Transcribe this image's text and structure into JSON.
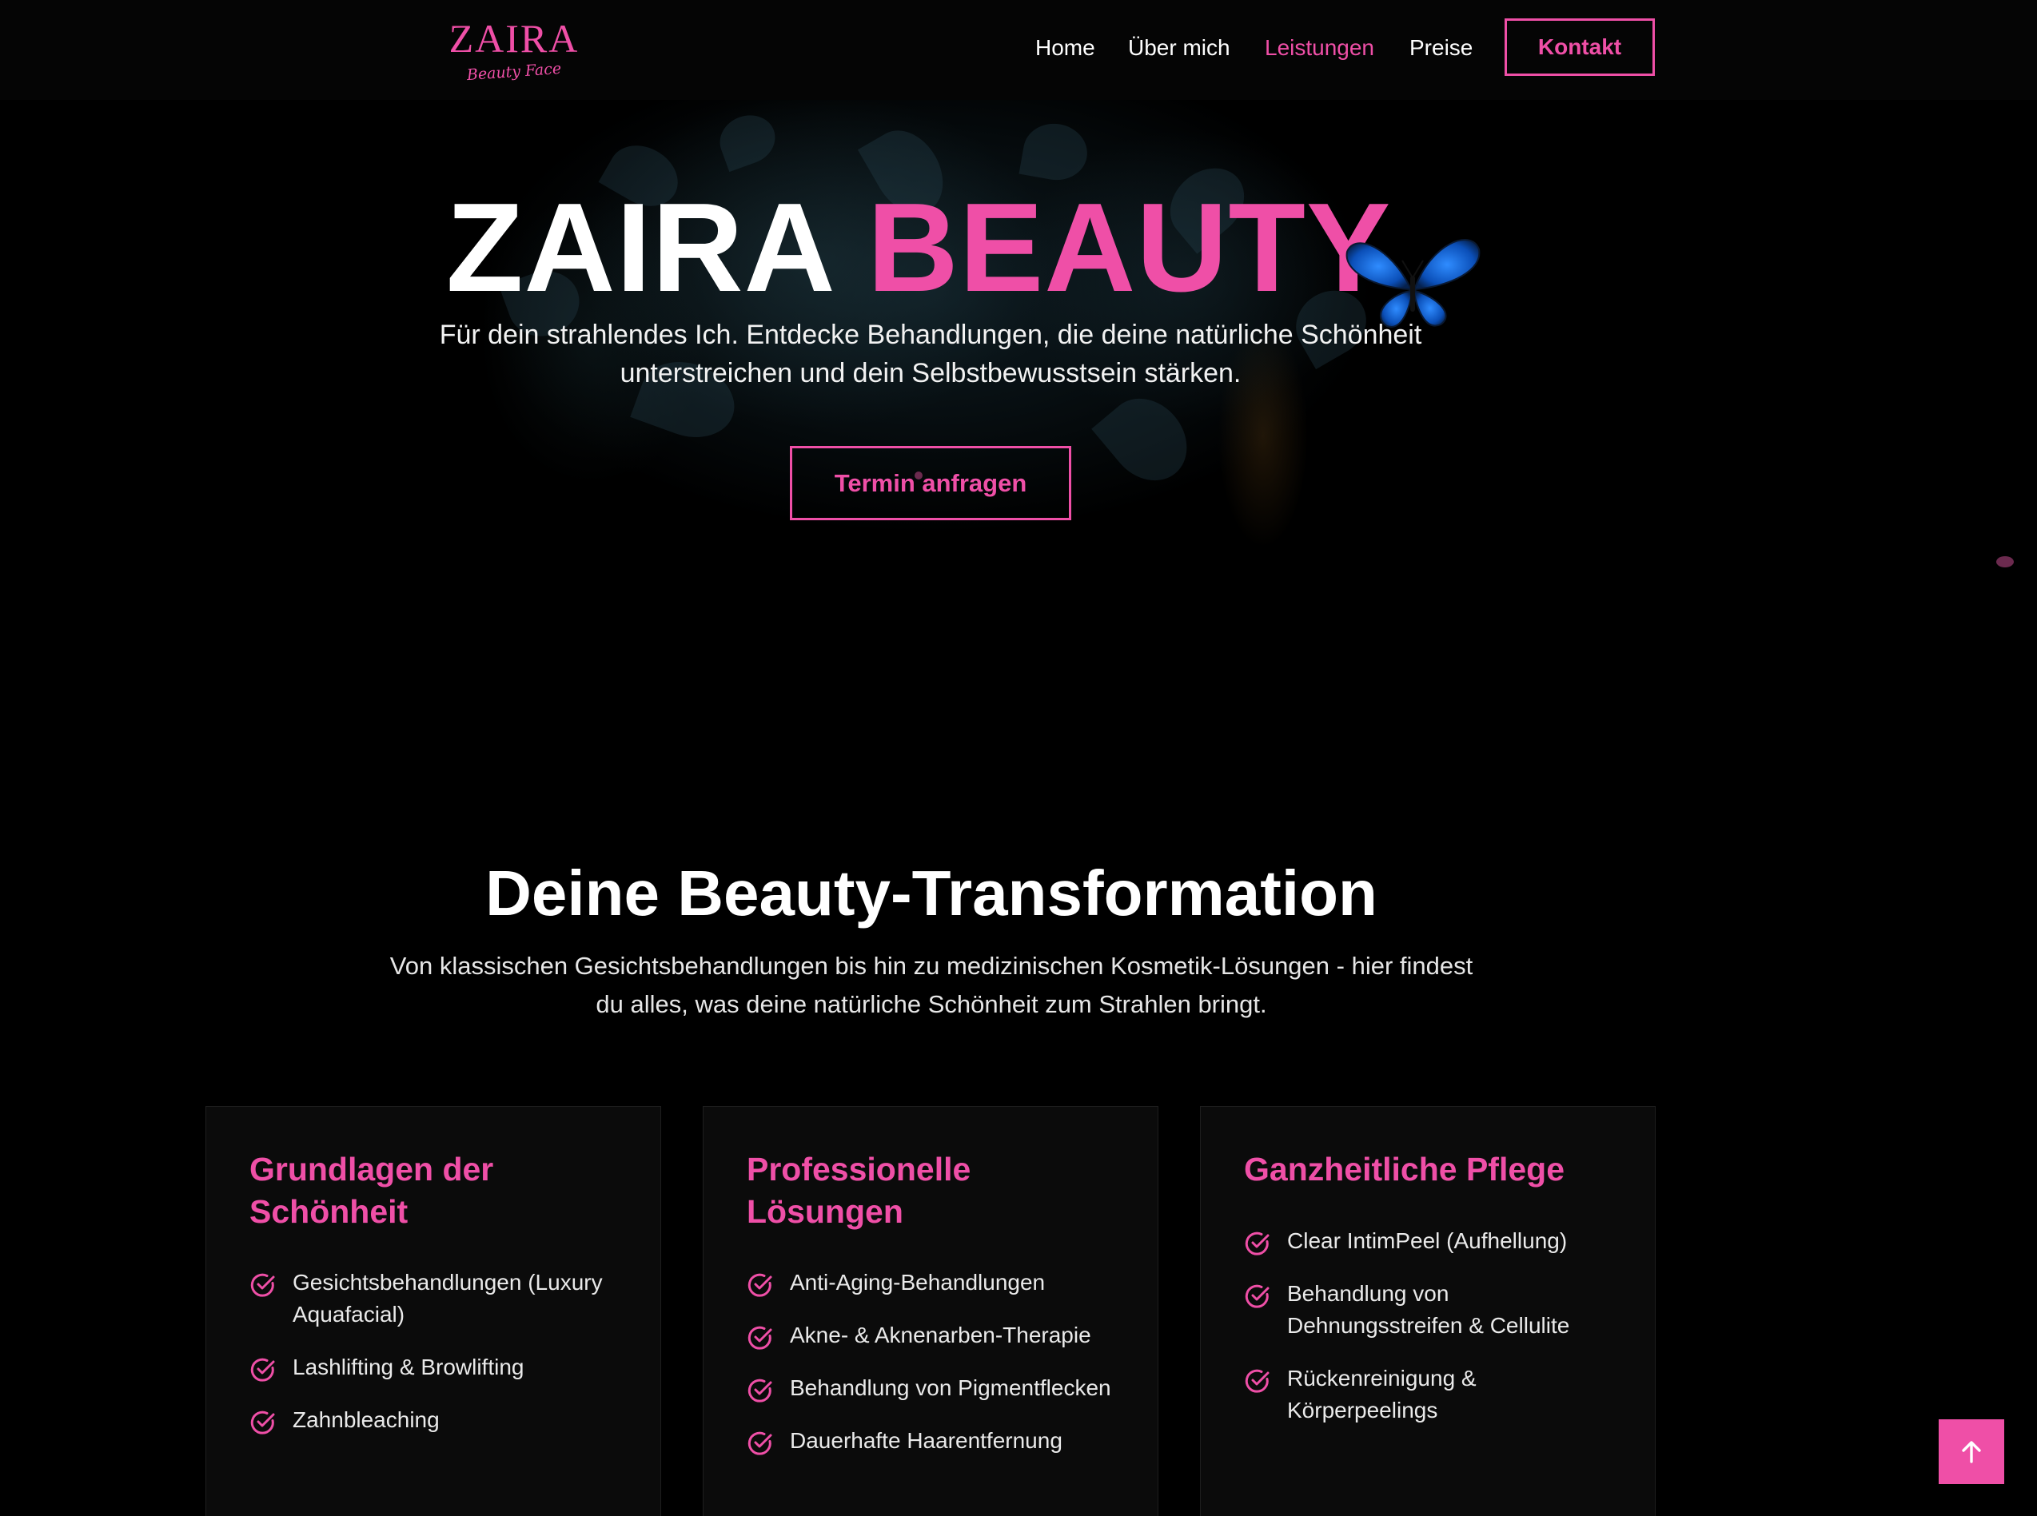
{
  "nav": {
    "logo_main": "ZAIRA",
    "logo_sub": "Beauty Face",
    "links": [
      "Home",
      "Über mich",
      "Leistungen",
      "Preise"
    ],
    "active": "Leistungen",
    "contact_label": "Kontakt"
  },
  "hero": {
    "title_white": "ZAIRA",
    "title_pink": "BEAUTY",
    "subtitle": "Für dein strahlendes Ich. Entdecke Behandlungen, die deine natürliche Schönheit unterstreichen und dein Selbstbewusstsein stärken.",
    "cta_label": "Termin anfragen"
  },
  "section": {
    "title": "Deine Beauty-Transformation",
    "subtitle": "Von klassischen Gesichtsbehandlungen bis hin zu medizinischen Kosmetik-Lösungen - hier findest du alles, was deine natürliche Schönheit zum Strahlen bringt."
  },
  "cards": [
    {
      "title": "Grundlagen der Schönheit",
      "items": [
        "Gesichtsbehandlungen (Luxury Aquafacial)",
        "Lashlifting & Browlifting",
        "Zahnbleaching"
      ]
    },
    {
      "title": "Professionelle Lösungen",
      "items": [
        "Anti-Aging-Behandlungen",
        "Akne- & Aknenarben-Therapie",
        "Behandlung von Pigmentflecken",
        "Dauerhafte Haarentfernung"
      ]
    },
    {
      "title": "Ganzheitliche Pflege",
      "items": [
        "Clear IntimPeel (Aufhellung)",
        "Behandlung von Dehnungsstreifen & Cellulite",
        "Rückenreinigung & Körperpeelings"
      ]
    }
  ],
  "icons": {
    "check": "check-circle-icon",
    "to_top": "arrow-up-icon",
    "butterfly": "butterfly-icon"
  },
  "colors": {
    "accent": "#ef4fa7",
    "background": "#000000",
    "card": "#0b0b0b"
  }
}
